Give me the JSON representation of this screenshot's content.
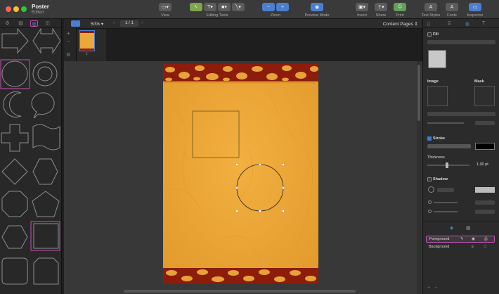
{
  "window": {
    "title": "Poster",
    "subtitle": "Edited"
  },
  "toolbar": {
    "view_label": "View",
    "editing_tools_label": "Editing Tools",
    "zoom_label": "Zoom",
    "preview_mode_label": "Preview Mode",
    "insert_label": "Insert",
    "share_label": "Share",
    "print_label": "Print",
    "text_styles_label": "Text Styles",
    "fonts_label": "Fonts",
    "inspector_label": "Inspector",
    "zoom_in_icon": "+",
    "zoom_out_icon": "−",
    "fonts_glyph": "A",
    "text_styles_glyph": "A"
  },
  "canvas_bar": {
    "zoom_value": "50%",
    "page_counter": "1 / 1",
    "content_pages": "Content Pages"
  },
  "thumbnails": {
    "page_number": "1"
  },
  "inspector": {
    "fill_label": "Fill",
    "image_label": "Image",
    "mask_label": "Mask",
    "stroke_label": "Stroke",
    "thickness_label": "Thickness",
    "thickness_value": "1,00 pt",
    "shadow_label": "Shadow",
    "stroke_color": "#000000",
    "fill_swatch": "#c8c8c8",
    "stroke_checked": true
  },
  "layers": [
    {
      "name": "Foreground",
      "selected": true
    },
    {
      "name": "Background",
      "selected": false
    }
  ],
  "colors": {
    "accent": "#c84fb8",
    "select_blue": "#3a7cd6",
    "page": "#eaa83a",
    "leopard": "#8c1d0b"
  }
}
